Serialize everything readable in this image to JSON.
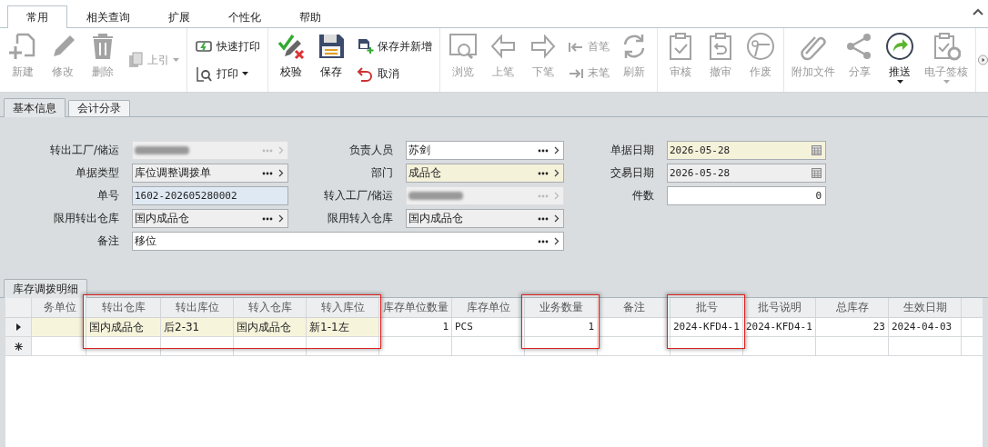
{
  "ribbon": {
    "tabs": [
      {
        "label": "常用",
        "selected": true
      },
      {
        "label": "相关查询",
        "selected": false
      },
      {
        "label": "扩展",
        "selected": false
      },
      {
        "label": "个性化",
        "selected": false
      },
      {
        "label": "帮助",
        "selected": false
      }
    ],
    "groups": [
      {
        "items": [
          {
            "kind": "large",
            "label": "新建",
            "disabled": true
          },
          {
            "kind": "large",
            "label": "修改",
            "disabled": true
          },
          {
            "kind": "large",
            "label": "删除",
            "disabled": true
          },
          {
            "kind": "stack",
            "items": [
              {
                "label": "上引",
                "disabled": true,
                "dropdown": true
              }
            ]
          }
        ]
      },
      {
        "items": [
          {
            "kind": "stack",
            "items": [
              {
                "label": "快速打印",
                "disabled": false
              },
              {
                "label": "打印",
                "disabled": false,
                "dropdown": true
              }
            ]
          }
        ]
      },
      {
        "items": [
          {
            "kind": "large",
            "label": "校验",
            "disabled": false
          },
          {
            "kind": "large",
            "label": "保存",
            "disabled": false
          },
          {
            "kind": "stack",
            "items": [
              {
                "label": "保存并新增",
                "disabled": false
              },
              {
                "label": "取消",
                "disabled": false
              }
            ]
          }
        ]
      },
      {
        "items": [
          {
            "kind": "large",
            "label": "浏览",
            "disabled": true
          },
          {
            "kind": "large",
            "label": "上笔",
            "disabled": true
          },
          {
            "kind": "large",
            "label": "下笔",
            "disabled": true
          },
          {
            "kind": "stack",
            "items": [
              {
                "label": "首笔",
                "disabled": true
              },
              {
                "label": "末笔",
                "disabled": true
              }
            ]
          },
          {
            "kind": "large",
            "label": "刷新",
            "disabled": true
          }
        ]
      },
      {
        "items": [
          {
            "kind": "large",
            "label": "审核",
            "disabled": true
          },
          {
            "kind": "large",
            "label": "撤审",
            "disabled": true
          },
          {
            "kind": "large",
            "label": "作废",
            "disabled": true
          }
        ]
      },
      {
        "items": [
          {
            "kind": "large",
            "label": "附加文件",
            "disabled": true
          },
          {
            "kind": "large",
            "label": "分享",
            "disabled": true
          },
          {
            "kind": "large",
            "label": "推送",
            "disabled": false,
            "dropdown": true
          },
          {
            "kind": "large",
            "label": "电子签核",
            "disabled": true,
            "dropdown": true
          }
        ]
      }
    ]
  },
  "form_tabs": [
    {
      "label": "基本信息",
      "selected": true
    },
    {
      "label": "会计分录",
      "selected": false
    }
  ],
  "form": {
    "fields": [
      {
        "label": "转出工厂/储运",
        "kind": "lookup",
        "readonly": true,
        "blurred": true
      },
      {
        "label": "负责人员",
        "kind": "lookup",
        "value": "苏剑"
      },
      {
        "label": "单据日期",
        "kind": "date",
        "required": true,
        "value": "2026-05-28"
      },
      {
        "label": "单据类型",
        "kind": "lookup",
        "readonly": true,
        "value": "库位调整调拨单"
      },
      {
        "label": "部门",
        "kind": "lookup",
        "required": true,
        "value": "成品仓"
      },
      {
        "label": "交易日期",
        "kind": "date",
        "readonly": true,
        "value": "2026-05-28"
      },
      {
        "label": "单号",
        "kind": "text",
        "focused": true,
        "value": "1602-202605280002"
      },
      {
        "label": "转入工厂/储运",
        "kind": "lookup",
        "readonly": true,
        "blurred": true
      },
      {
        "label": "件数",
        "kind": "number",
        "value": "0"
      },
      {
        "label": "限用转出仓库",
        "kind": "lookup",
        "readonly": true,
        "value": "国内成品仓"
      },
      {
        "label": "限用转入仓库",
        "kind": "lookup",
        "readonly": true,
        "value": "国内成品仓"
      },
      {
        "label": "备注",
        "kind": "lookup",
        "value": "移位",
        "wide": true
      }
    ]
  },
  "detail_tabs": [
    {
      "label": "库存调拨明细",
      "selected": true
    }
  ],
  "table": {
    "columns": [
      {
        "label": "务单位",
        "editable": true
      },
      {
        "label": "转出仓库",
        "editable": true,
        "highlighted": true
      },
      {
        "label": "转出库位",
        "editable": true,
        "highlighted": true
      },
      {
        "label": "转入仓库",
        "editable": true,
        "highlighted": true
      },
      {
        "label": "转入库位",
        "editable": true,
        "highlighted": true
      },
      {
        "label": "库存单位数量",
        "numeric": true
      },
      {
        "label": "库存单位"
      },
      {
        "label": "业务数量",
        "highlighted": true,
        "numeric": true
      },
      {
        "label": "备注"
      },
      {
        "label": "批号",
        "highlighted": true
      },
      {
        "label": "批号说明"
      },
      {
        "label": "总库存",
        "numeric": true
      },
      {
        "label": "生效日期"
      }
    ],
    "rows": [
      {
        "current": true,
        "cells": [
          null,
          "国内成品仓",
          "后2-31",
          "国内成品仓",
          "新1-1左",
          "1",
          "PCS",
          "1",
          null,
          "2024-KFD4-1",
          "2024-KFD4-1",
          "23",
          "2024-04-03"
        ]
      },
      {
        "new_row": true
      }
    ]
  }
}
